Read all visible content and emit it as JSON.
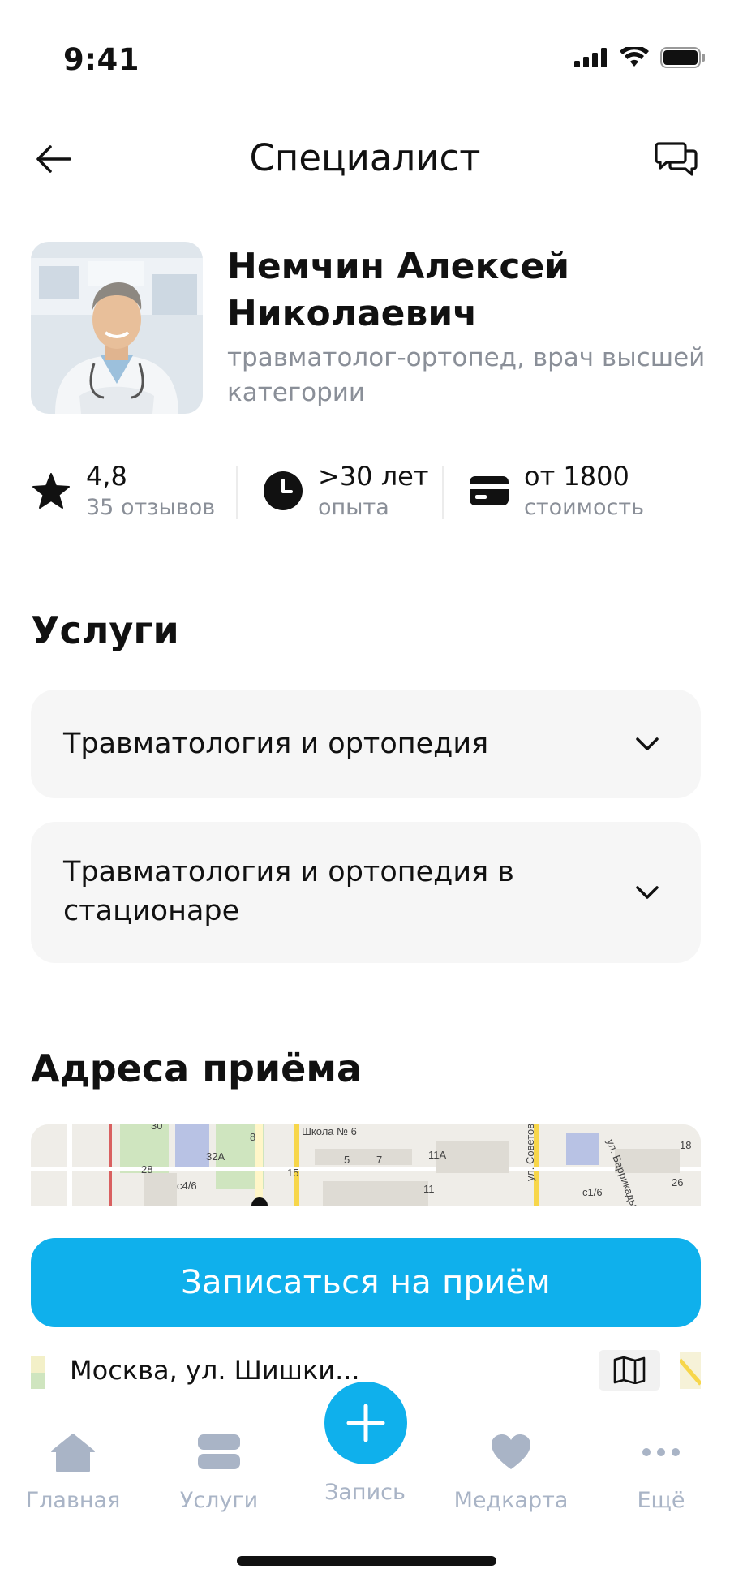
{
  "status_bar": {
    "time": "9:41"
  },
  "nav": {
    "title": "Специалист"
  },
  "doctor": {
    "name": "Немчин Алексей Николаевич",
    "specialization": "травматолог-ортопед, врач высшей категории"
  },
  "stats": [
    {
      "icon": "star-icon",
      "value": "4,8",
      "label": "35 отзывов"
    },
    {
      "icon": "clock-icon",
      "value": ">30 лет",
      "label": "опыта"
    },
    {
      "icon": "card-icon",
      "value": "от 1800",
      "label": "стоимость"
    }
  ],
  "services": {
    "title": "Услуги",
    "items": [
      {
        "label": "Травматология и ортопедия"
      },
      {
        "label": "Травматология и ортопедия в стационаре"
      }
    ]
  },
  "addresses": {
    "title": "Адреса приёма",
    "map_labels": [
      "Школа № 6",
      "ул. Советов",
      "ул. Баррикады",
      "32А",
      "28",
      "30",
      "15",
      "5",
      "7",
      "11А",
      "11",
      "с1/6",
      "18",
      "26",
      "с4/6",
      "8"
    ],
    "address": "Москва, ул. Шишки..."
  },
  "cta": {
    "label": "Записаться на приём"
  },
  "tab_bar": {
    "items": [
      {
        "label": "Главная",
        "icon": "home-icon"
      },
      {
        "label": "Услуги",
        "icon": "services-icon"
      },
      {
        "label": "Запись",
        "icon": "plus-icon"
      },
      {
        "label": "Медкарта",
        "icon": "heart-icon"
      },
      {
        "label": "Ещё",
        "icon": "more-icon"
      }
    ]
  },
  "colors": {
    "accent": "#0fb0ec",
    "muted_text": "#8a8f98",
    "tab_inactive": "#a9b4c6",
    "card_bg": "#f6f6f6"
  }
}
